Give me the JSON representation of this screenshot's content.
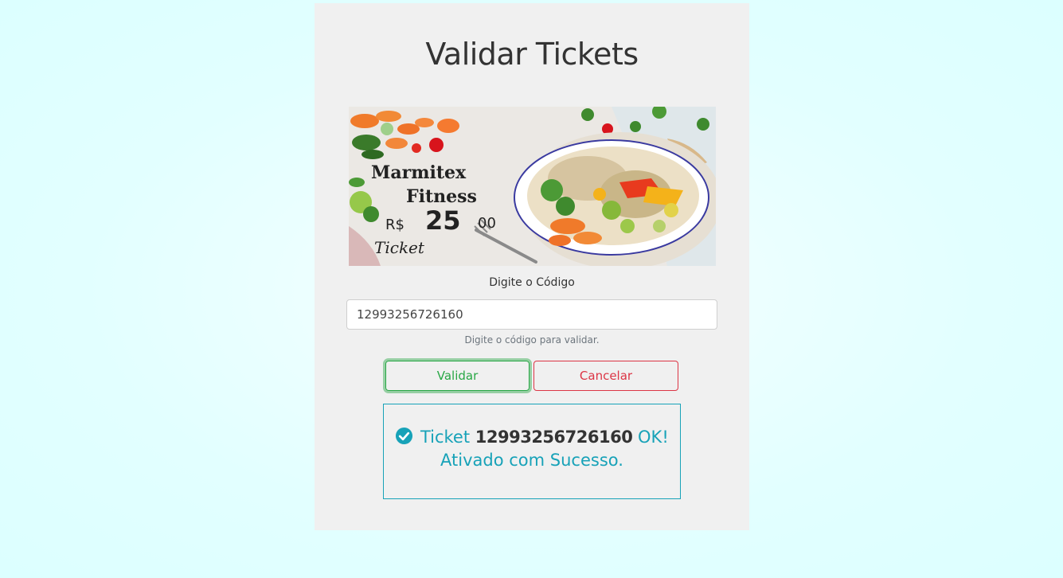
{
  "page": {
    "title": "Validar Tickets"
  },
  "banner": {
    "line1": "Marmitex",
    "line2": "Fitness",
    "currency": "R$",
    "price": "25",
    "cents": "00",
    "ticket_word": "Ticket"
  },
  "form": {
    "label": "Digite o Código",
    "code_value": "12993256726160",
    "help": "Digite o código para validar."
  },
  "buttons": {
    "validate_label": "Validar",
    "cancel_label": "Cancelar"
  },
  "result": {
    "icon": "check-circle-icon",
    "prefix": "Ticket",
    "code": "12993256726160",
    "ok": "OK!",
    "message": "Ativado com Sucesso."
  },
  "colors": {
    "success": "#28a745",
    "danger": "#dc3545",
    "info": "#17a2b8",
    "card_bg": "#f0f0f0",
    "page_bg": "#e0ffff"
  }
}
